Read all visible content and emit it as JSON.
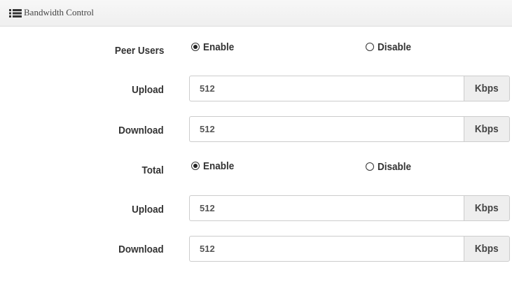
{
  "header": {
    "icon": "list-icon",
    "title": "Bandwidth Control"
  },
  "peer_users": {
    "label": "Peer Users",
    "enable_label": "Enable",
    "disable_label": "Disable",
    "selected": "Enable",
    "upload": {
      "label": "Upload",
      "value": "512",
      "unit": "Kbps"
    },
    "download": {
      "label": "Download",
      "value": "512",
      "unit": "Kbps"
    }
  },
  "total": {
    "label": "Total",
    "enable_label": "Enable",
    "disable_label": "Disable",
    "selected": "Enable",
    "upload": {
      "label": "Upload",
      "value": "512",
      "unit": "Kbps"
    },
    "download": {
      "label": "Download",
      "value": "512",
      "unit": "Kbps"
    }
  }
}
